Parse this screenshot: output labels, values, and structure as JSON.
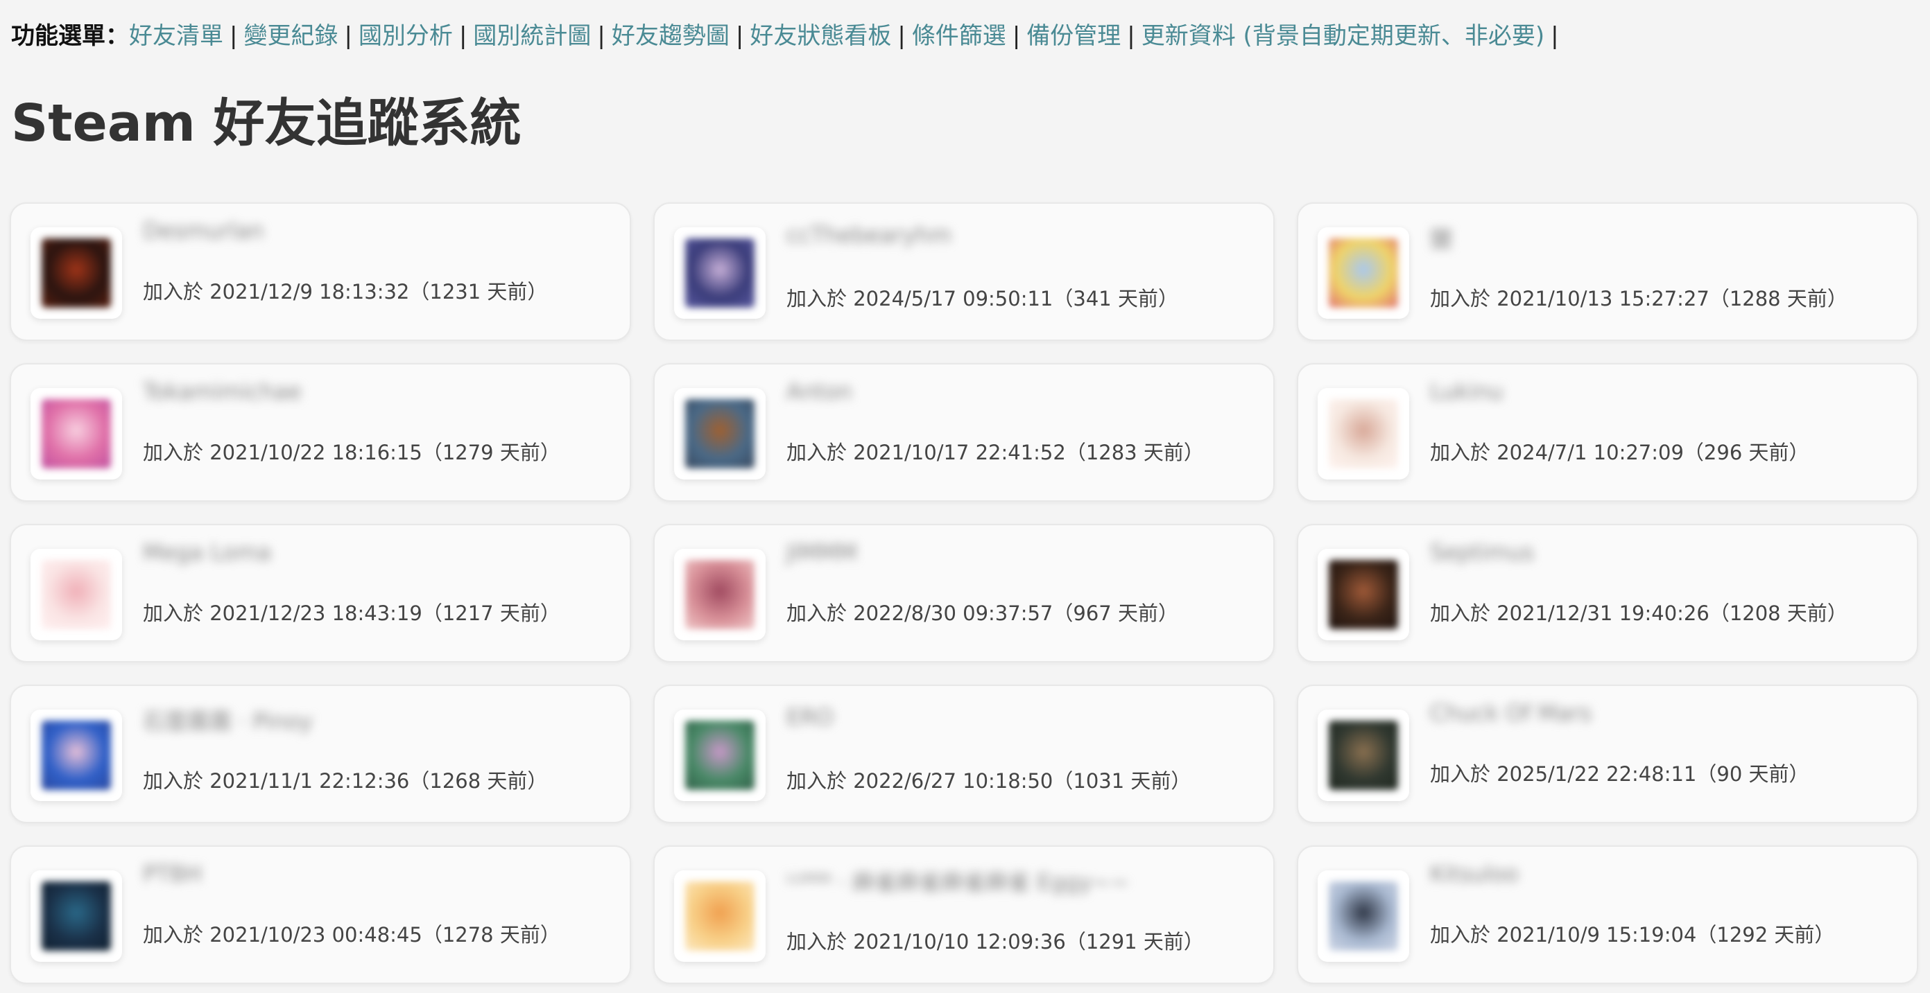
{
  "menu": {
    "label": "功能選單：",
    "items": [
      "好友清單",
      "變更紀錄",
      "國別分析",
      "國別統計圖",
      "好友趨勢圖",
      "好友狀態看板",
      "條件篩選",
      "備份管理",
      "更新資料 (背景自動定期更新、非必要)"
    ]
  },
  "page": {
    "title": "Steam 好友追蹤系統"
  },
  "friends": [
    {
      "name": "Desmurlan",
      "joined": "加入於 2021/12/9 18:13:32（1231 天前）",
      "avatar_colors": [
        "#2a1410",
        "#a03418",
        "#5a2010"
      ]
    },
    {
      "name": "ccThebearyhm",
      "joined": "加入於 2024/5/17 09:50:11（341 天前）",
      "avatar_colors": [
        "#3a3c7a",
        "#c8b0d8",
        "#5a5aa0"
      ]
    },
    {
      "name": "鹽",
      "joined": "加入於 2021/10/13 15:27:27（1288 天前）",
      "avatar_colors": [
        "#f0d468",
        "#a8c8f0",
        "#e07070"
      ]
    },
    {
      "name": "Tokamimichae",
      "joined": "加入於 2021/10/22 18:16:15（1279 天前）",
      "avatar_colors": [
        "#e070a8",
        "#f8d0e0",
        "#c050a0"
      ]
    },
    {
      "name": "Anton",
      "joined": "加入於 2021/10/17 22:41:52（1283 天前）",
      "avatar_colors": [
        "#4a6a88",
        "#a06030",
        "#3a4a60"
      ]
    },
    {
      "name": "Lukinu",
      "joined": "加入於 2024/7/1 10:27:09（296 天前）",
      "avatar_colors": [
        "#f6e8e0",
        "#d8a898",
        "#fff4f0"
      ]
    },
    {
      "name": "Mega Loma",
      "joined": "加入於 2021/12/23 18:43:19（1217 天前）",
      "avatar_colors": [
        "#fae4e4",
        "#f0b0b8",
        "#fff0f0"
      ]
    },
    {
      "name": "JIMMM",
      "joined": "加入於 2022/8/30 09:37:57（967 天前）",
      "avatar_colors": [
        "#d89098",
        "#a04a60",
        "#f0c8c8"
      ]
    },
    {
      "name": "Septimus",
      "joined": "加入於 2021/12/31 19:40:26（1208 天前）",
      "avatar_colors": [
        "#3a2418",
        "#a05a38",
        "#201410"
      ]
    },
    {
      "name": "石雲霧霧 · Pinoy",
      "joined": "加入於 2021/11/1 22:12:36（1268 天前）",
      "avatar_colors": [
        "#3060c8",
        "#e8c0d8",
        "#2a48a0"
      ]
    },
    {
      "name": "ERO",
      "joined": "加入於 2022/6/27 10:18:50（1031 天前）",
      "avatar_colors": [
        "#4a8a68",
        "#c898c8",
        "#306048"
      ]
    },
    {
      "name": "Chuck Of Mars",
      "joined": "加入於 2025/1/22 22:48:11（90 天前）",
      "avatar_colors": [
        "#303830",
        "#8a7050",
        "#202820"
      ]
    },
    {
      "name": "PTBH",
      "joined": "加入於 2021/10/23 00:48:45（1278 天前）",
      "avatar_colors": [
        "#1a3048",
        "#2a6888",
        "#102030"
      ]
    },
    {
      "name": "ᴸᵁᴹᴵᴺ · 麻雀麻雀麻雀麻雀 Eggy∼∼",
      "joined": "加入於 2021/10/10 12:09:36（1291 天前）",
      "avatar_colors": [
        "#f8d088",
        "#f0a050",
        "#fce8c0"
      ]
    },
    {
      "name": "Kitsuloo",
      "joined": "加入於 2021/10/9 15:19:04（1292 天前）",
      "avatar_colors": [
        "#a8b8d0",
        "#303848",
        "#d0d8e8"
      ]
    }
  ]
}
